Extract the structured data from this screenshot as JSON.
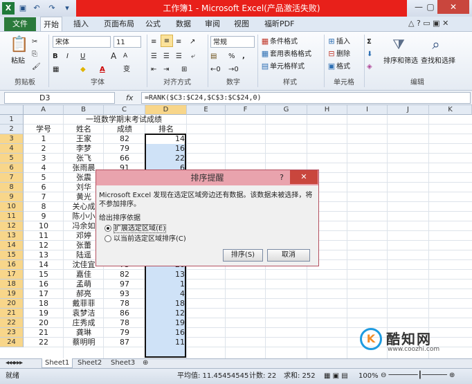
{
  "window": {
    "title": "工作簿1 - Microsoft Excel(产品激活失败)",
    "minimize": "—",
    "maximize": "▢",
    "close": "✕"
  },
  "tabs": [
    "文件",
    "开始",
    "插入",
    "页面布局",
    "公式",
    "数据",
    "审阅",
    "视图",
    "福昕PDF"
  ],
  "ribbon": {
    "clipboard": {
      "label": "剪贴板",
      "paste": "粘贴"
    },
    "font": {
      "label": "字体",
      "name": "宋体",
      "size": "11",
      "bold": "B",
      "italic": "I",
      "underline": "U",
      "text_color_letter": "A",
      "grow": "A",
      "shrink": "A",
      "phonetic": "变"
    },
    "alignment": {
      "label": "对齐方式"
    },
    "number": {
      "label": "数字",
      "format": "常规",
      "percent": "%",
      "comma": ","
    },
    "styles": {
      "label": "样式",
      "conditional": "条件格式",
      "table": "套用表格格式",
      "cell": "单元格样式"
    },
    "cells": {
      "label": "单元格",
      "insert": "插入",
      "delete": "删除",
      "format": "格式"
    },
    "editing": {
      "label": "编辑",
      "sort": "排序和筛选",
      "find": "查找和选择"
    }
  },
  "namebox": "D3",
  "fx": "fx",
  "formula": "=RANK($C3:$C24,$C$3:$C$24,0)",
  "columns": [
    "A",
    "B",
    "C",
    "D",
    "E",
    "F",
    "G",
    "H",
    "I",
    "J",
    "K"
  ],
  "rows": [
    "1",
    "2",
    "3",
    "4",
    "5",
    "6",
    "7",
    "8",
    "9",
    "10",
    "11",
    "12",
    "13",
    "14",
    "15",
    "16",
    "17",
    "18",
    "19",
    "20",
    "21",
    "22",
    "23",
    "24"
  ],
  "sheet": {
    "title": "一班数学期末考试成绩",
    "headers": [
      "学号",
      "姓名",
      "成绩",
      "排名"
    ],
    "data": [
      [
        "1",
        "王家",
        "82",
        "14"
      ],
      [
        "2",
        "李梦",
        "79",
        "16"
      ],
      [
        "3",
        "张飞",
        "66",
        "22"
      ],
      [
        "4",
        "张雨晨",
        "91",
        "6"
      ],
      [
        "5",
        "张震",
        "",
        ""
      ],
      [
        "6",
        "刘华",
        "",
        ""
      ],
      [
        "7",
        "黄光",
        "",
        ""
      ],
      [
        "8",
        "关心成",
        "",
        ""
      ],
      [
        "9",
        "陈小小",
        "",
        ""
      ],
      [
        "10",
        "冯余如",
        "",
        ""
      ],
      [
        "11",
        "邓婷",
        "",
        ""
      ],
      [
        "12",
        "张蕾",
        "",
        ""
      ],
      [
        "13",
        "陆遥",
        "",
        ""
      ],
      [
        "14",
        "沈佳宜",
        "75",
        "20"
      ],
      [
        "15",
        "嘉佳",
        "82",
        "13"
      ],
      [
        "16",
        "孟萌",
        "97",
        "1"
      ],
      [
        "17",
        "郝亮",
        "93",
        "4"
      ],
      [
        "18",
        "戴菲菲",
        "78",
        "18"
      ],
      [
        "19",
        "袁梦洁",
        "86",
        "12"
      ],
      [
        "20",
        "庄秀成",
        "78",
        "19"
      ],
      [
        "21",
        "龚琳",
        "79",
        "16"
      ],
      [
        "22",
        "蔡明明",
        "87",
        "11"
      ]
    ]
  },
  "dialog": {
    "title": "排序提醒",
    "help": "?",
    "close": "✕",
    "message": "Microsoft Excel 发现在选定区域旁边还有数据。该数据未被选择，将不参加排序。",
    "group_label": "给出排序依据",
    "option1": "扩展选定区域(E)",
    "option2": "以当前选定区域排序(C)",
    "sort_button": "排序(S)",
    "cancel_button": "取消"
  },
  "sheet_tabs": [
    "Sheet1",
    "Sheet2",
    "Sheet3"
  ],
  "status": {
    "ready": "就绪",
    "average": "平均值: 11.45454545",
    "count": "计数: 22",
    "sum": "求和: 252",
    "zoom": "100%"
  },
  "watermark": {
    "brand": "酷知网",
    "url": "www.coozhi.com"
  },
  "colors": {
    "title_red": "#e8201a",
    "file_green": "#2a7a3b",
    "selection": "#cfe2f7",
    "dialog_title": "#e9a3ad"
  }
}
